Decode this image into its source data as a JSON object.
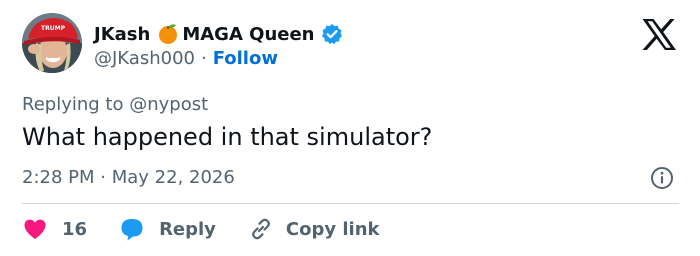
{
  "author": {
    "display_name": "JKash",
    "display_name_suffix": "MAGA Queen",
    "name_emoji_icon": "orange-fruit-icon",
    "verified_icon": "verified-badge-icon",
    "handle": "@JKash000",
    "separator": "·",
    "follow_label": "Follow",
    "avatar_hat_text": "TRUMP"
  },
  "platform": {
    "logo_icon": "x-logo-icon"
  },
  "reply_context": {
    "prefix": "Replying to",
    "handle": "@nypost"
  },
  "tweet": {
    "text": "What happened in that simulator?",
    "time": "2:28 PM",
    "separator": "·",
    "date": "May 22, 2026"
  },
  "actions": {
    "like_icon": "heart-icon",
    "like_count": "16",
    "reply_icon": "speech-bubble-icon",
    "reply_label": "Reply",
    "copy_icon": "link-icon",
    "copy_label": "Copy link",
    "info_icon": "info-icon"
  },
  "colors": {
    "text_primary": "#0f1419",
    "text_secondary": "#536471",
    "link_blue": "#006fd6",
    "verified_blue": "#1d9bf0",
    "like_pink": "#f91880",
    "divider": "#cfd9de"
  }
}
